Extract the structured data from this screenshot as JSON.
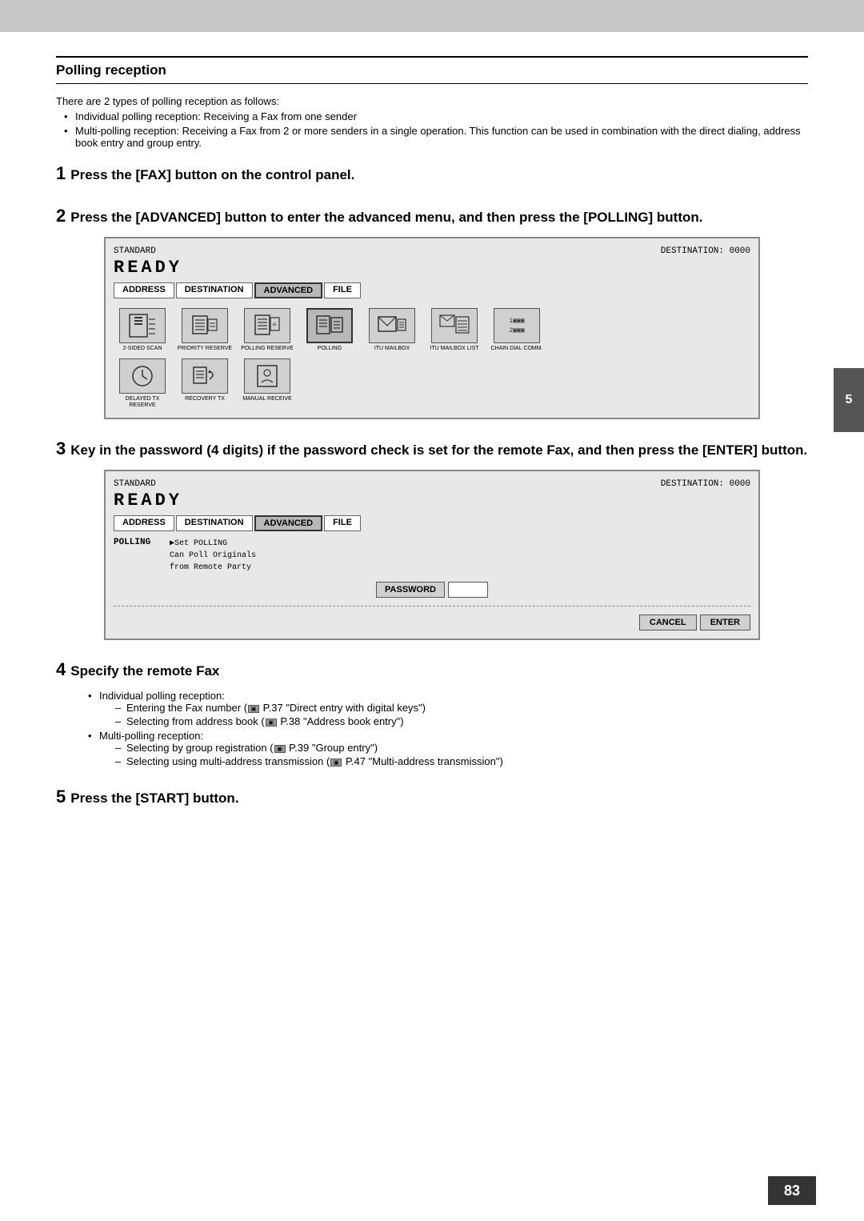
{
  "page": {
    "top_bar_color": "#c8c8c8",
    "background": "#fff",
    "side_tab_number": "5",
    "page_number": "83"
  },
  "section": {
    "title": "Polling reception"
  },
  "intro": {
    "line1": "There are 2 types of polling reception as follows:",
    "bullet1": "Individual polling reception: Receiving a Fax from one sender",
    "bullet2": "Multi-polling reception: Receiving a Fax from 2 or more senders in a single operation. This function can be used in combination with the direct dialing, address book entry and group entry."
  },
  "steps": [
    {
      "num": "1",
      "text": "Press the [FAX] button on the control panel."
    },
    {
      "num": "2",
      "text": "Press the [ADVANCED] button to enter the advanced menu, and then press the [POLLING] button."
    },
    {
      "num": "3",
      "text": "Key in the password (4 digits) if the password check is set for the remote Fax, and then press the [ENTER] button."
    },
    {
      "num": "4",
      "text": "Specify the remote Fax"
    },
    {
      "num": "5",
      "text": "Press the [START] button."
    }
  ],
  "screen1": {
    "status_left": "STANDARD",
    "status_right": "DESTINATION: 0000",
    "ready_text": "READY",
    "tabs": [
      "ADDRESS",
      "DESTINATION",
      "ADVANCED",
      "FILE"
    ],
    "icons": [
      {
        "label": "2-SIDED SCAN"
      },
      {
        "label": "PRIORITY RESERVE"
      },
      {
        "label": "POLLING RESERVE"
      },
      {
        "label": "POLLING"
      },
      {
        "label": "ITU MAILBOX"
      },
      {
        "label": "ITU MAILBOX LIST"
      },
      {
        "label": "CHAIN DIAL COMM."
      },
      {
        "label": "DELAYED TX RESERVE"
      },
      {
        "label": "RECOVERY TX"
      },
      {
        "label": "MANUAL RECEIVE"
      }
    ]
  },
  "screen2": {
    "status_left": "STANDARD",
    "status_right": "DESTINATION: 0000",
    "ready_text": "READY",
    "tabs": [
      "ADDRESS",
      "DESTINATION",
      "ADVANCED",
      "FILE"
    ],
    "polling_label": "POLLING",
    "polling_text_line1": "▶Set POLLING",
    "polling_text_line2": "Can Poll Originals",
    "polling_text_line3": "from Remote Party",
    "password_label": "PASSWORD",
    "cancel_label": "CANCEL",
    "enter_label": "ENTER"
  },
  "step4": {
    "individual_label": "Individual polling reception:",
    "individual_sub": [
      "Entering the Fax number (  P.37 \"Direct entry with digital keys\")",
      "Selecting from address book (  P.38 \"Address book entry\")"
    ],
    "multi_label": "Multi-polling reception:",
    "multi_sub": [
      "Selecting by group registration (  P.39 \"Group entry\")",
      "Selecting using multi-address transmission (  P.47 \"Multi-address transmission\")"
    ]
  }
}
